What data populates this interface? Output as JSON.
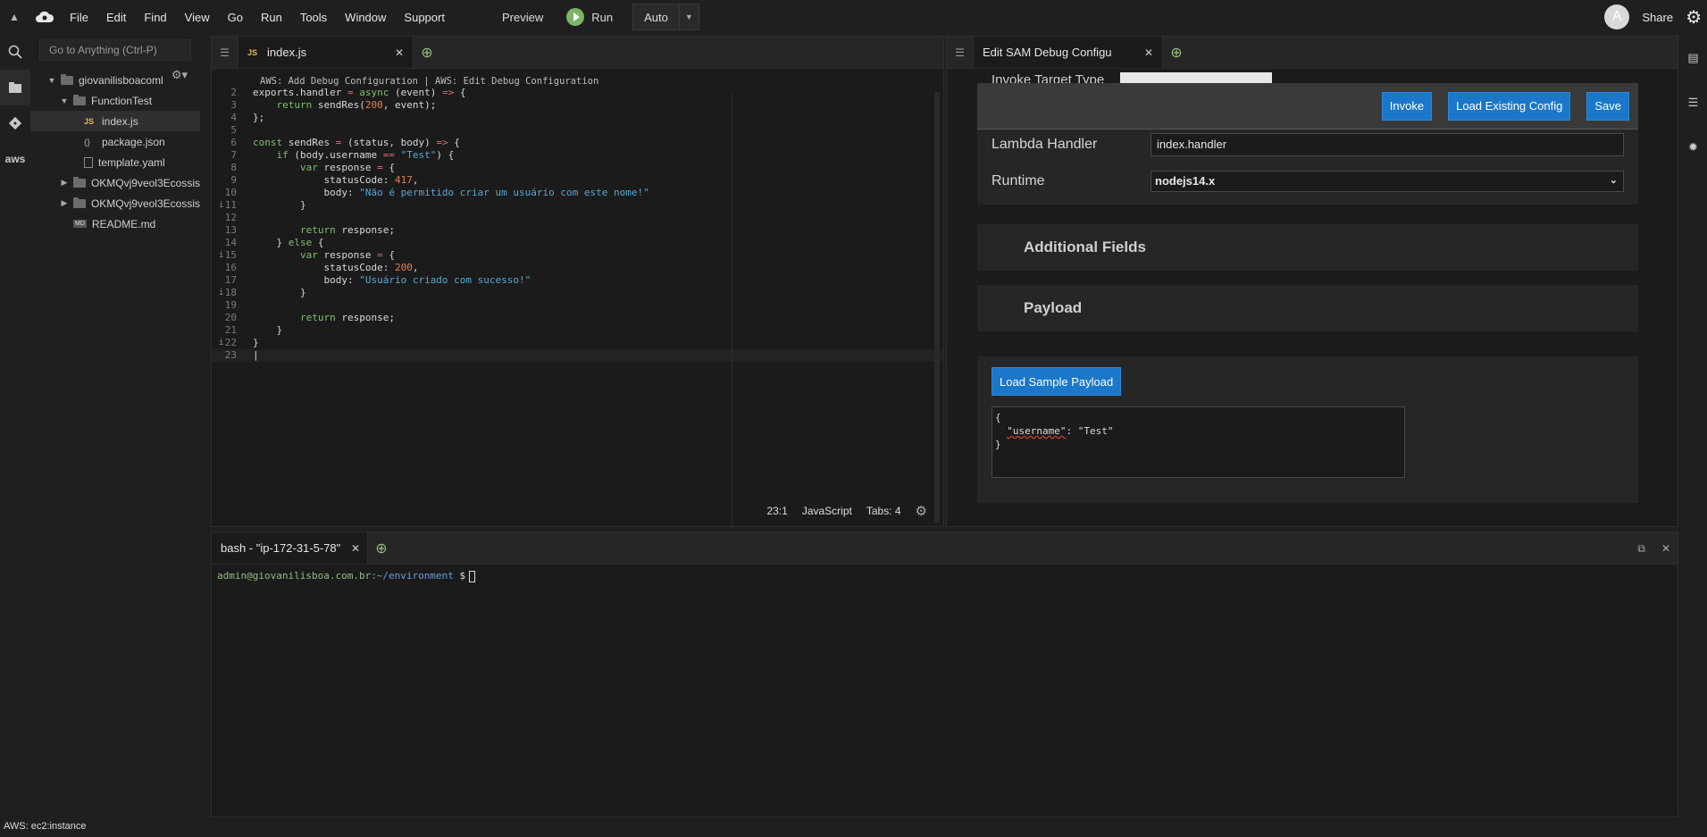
{
  "menubar": {
    "items": [
      "File",
      "Edit",
      "Find",
      "View",
      "Go",
      "Run",
      "Tools",
      "Window",
      "Support"
    ],
    "preview": "Preview",
    "run": "Run",
    "auto": "Auto",
    "avatar_initial": "A",
    "share": "Share"
  },
  "tree": {
    "goto_placeholder": "Go to Anything (Ctrl-P)",
    "root": "giovanilisboacoml",
    "folder1": "FunctionTest",
    "file_index": "index.js",
    "file_package": "package.json",
    "file_template": "template.yaml",
    "folder2": "OKMQvj9veol3Ecossis",
    "folder3": "OKMQvj9veol3Ecossis",
    "file_readme": "README.md"
  },
  "editor": {
    "tab_label": "index.js",
    "header": "AWS: Add Debug Configuration | AWS: Edit Debug Configuration",
    "status": {
      "position": "23:1",
      "language": "JavaScript",
      "tabs": "Tabs: 4"
    }
  },
  "rpane": {
    "tab_label": "Edit SAM Debug Configu",
    "peek_label": "Invoke Target Type",
    "buttons": {
      "invoke": "Invoke",
      "load_config": "Load Existing Config",
      "save": "Save"
    },
    "lambda_handler_label": "Lambda Handler",
    "lambda_handler_value": "index.handler",
    "runtime_label": "Runtime",
    "runtime_value": "nodejs14.x",
    "additional_fields": "Additional Fields",
    "payload": "Payload",
    "load_sample": "Load Sample Payload",
    "payload_open": "{",
    "payload_key": "\"username\"",
    "payload_rest": ": \"Test\"",
    "payload_close": "}"
  },
  "terminal": {
    "tab_label": "bash - \"ip-172-31-5-78\"",
    "user": "admin@giovanilisboa.com.br",
    "path": ":~/environment",
    "prompt": " $"
  },
  "status_bar": "AWS: ec2:instance"
}
